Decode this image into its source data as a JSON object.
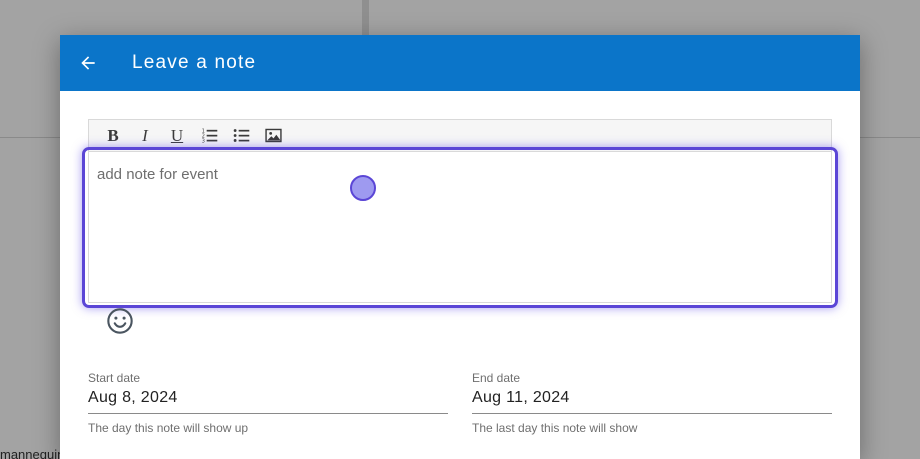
{
  "background": {
    "partial_text": "mannequin"
  },
  "dialog": {
    "title": "Leave a note",
    "back_icon": "arrow-left-icon",
    "header_color": "#0b75c9"
  },
  "toolbar": {
    "buttons": [
      {
        "label": "B",
        "name": "bold"
      },
      {
        "label": "I",
        "name": "italic"
      },
      {
        "label": "U",
        "name": "underline"
      },
      {
        "icon": "ordered-list-icon",
        "name": "ordered-list"
      },
      {
        "icon": "bullet-list-icon",
        "name": "bullet-list"
      },
      {
        "icon": "image-icon",
        "name": "insert-image"
      }
    ]
  },
  "editor": {
    "placeholder": "add note for event",
    "focus_color": "#5b46d6"
  },
  "emoji": {
    "icon": "smiley-icon"
  },
  "start_date": {
    "label": "Start date",
    "value": "Aug 8, 2024",
    "help": "The day this note will show up"
  },
  "end_date": {
    "label": "End date",
    "value": "Aug 11, 2024",
    "help": "The last day this note will show"
  }
}
